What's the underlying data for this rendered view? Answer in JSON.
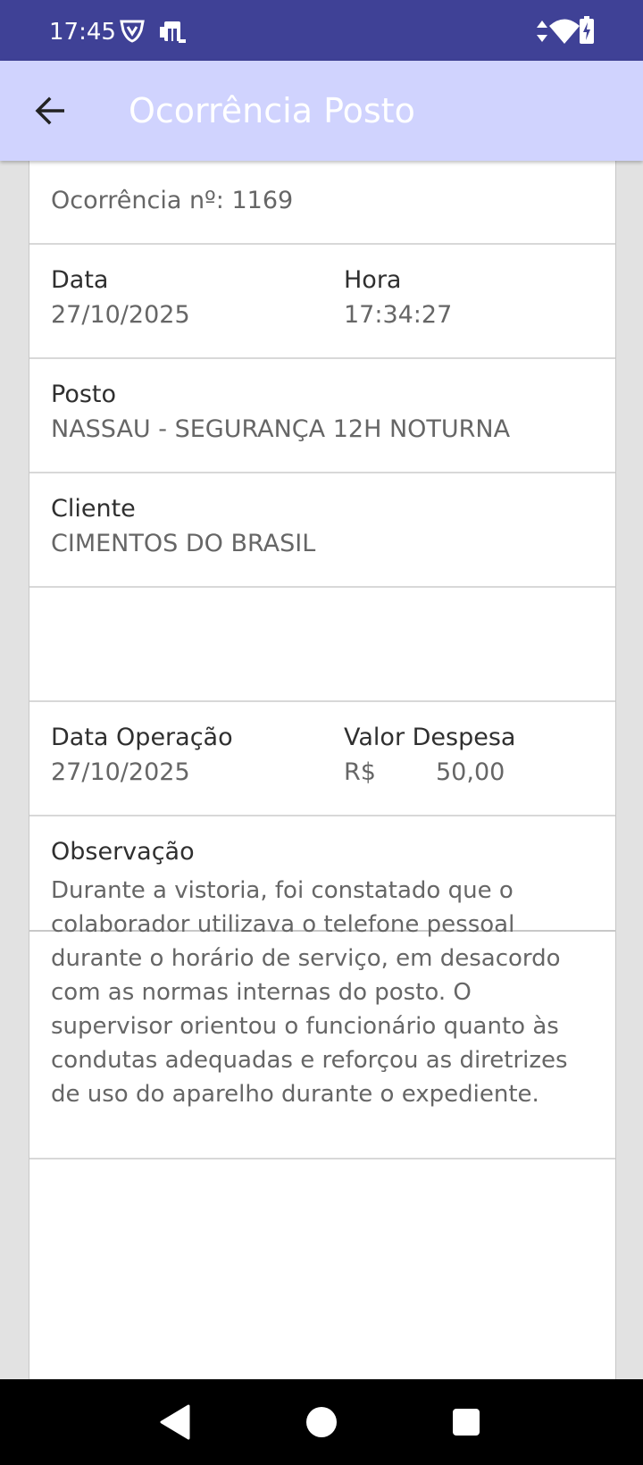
{
  "status_bar": {
    "time": "17:45",
    "icons": [
      "vpn-shield-icon",
      "sim-card-icon",
      "data-arrows-icon",
      "wifi-icon",
      "battery-charging-icon"
    ]
  },
  "app_bar": {
    "title": "Ocorrência Posto",
    "back_icon": "arrow-back-icon",
    "background": "#d0d3fe"
  },
  "occurrence": {
    "number_text": "Ocorrência nº: 1169",
    "data_label": "Data",
    "data_value": "27/10/2025",
    "hora_label": "Hora",
    "hora_value": "17:34:27",
    "posto_label": "Posto",
    "posto_value": "NASSAU - SEGURANÇA 12H NOTURNA",
    "cliente_label": "Cliente",
    "cliente_value": "CIMENTOS DO BRASIL",
    "data_operacao_label": "Data Operação",
    "data_operacao_value": "27/10/2025",
    "valor_despesa_label": "Valor Despesa",
    "valor_currency": "R$",
    "valor_amount": "50,00",
    "observacao_label": "Observação",
    "observacao_text": "Durante a vistoria, foi constatado que o colaborador utilizava o telefone pessoal durante o horário de serviço, em desacordo com as normas internas do posto. O supervisor orientou o funcionário quanto às condutas adequadas e reforçou as diretrizes de uso do aparelho durante o expediente."
  },
  "colors": {
    "status_bar": "#3f4196",
    "app_bar": "#d0d3fe",
    "page_background": "#e2e2e2"
  },
  "nav_bar": {
    "icons": [
      "back-triangle-icon",
      "home-circle-icon",
      "recents-square-icon"
    ]
  }
}
